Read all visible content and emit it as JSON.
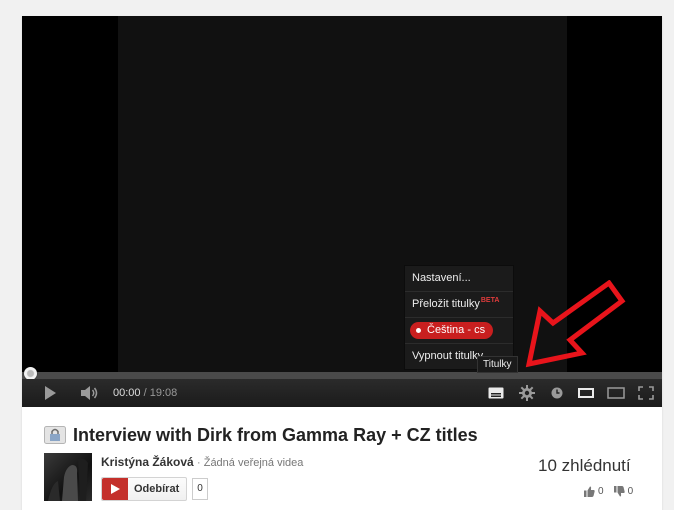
{
  "player": {
    "current_time": "00:00",
    "time_separator": "/",
    "duration": "19:08",
    "progress_fraction": 0
  },
  "settings_menu": {
    "settings_label": "Nastavení...",
    "translate_label": "Přeložit titulky",
    "translate_badge": "BETA",
    "active_track_label": "Čeština - cs",
    "turn_off_label": "Vypnout titulky"
  },
  "tooltip": {
    "text": "Titulky"
  },
  "video": {
    "title": "Interview with Dirk from Gamma Ray + CZ titles",
    "privacy_icon": "lock-icon",
    "channel_name": "Kristýna Žáková",
    "channel_separator": "·",
    "channel_videos": "Žádná veřejná videa",
    "subscribe_label": "Odebírat",
    "subscriber_count": "0",
    "views": "10 zhlédnutí",
    "likes": "0",
    "dislikes": "0"
  },
  "colors": {
    "accent_red": "#c91f1f",
    "annotation_arrow": "#e8141b",
    "player_bg": "#000000"
  }
}
